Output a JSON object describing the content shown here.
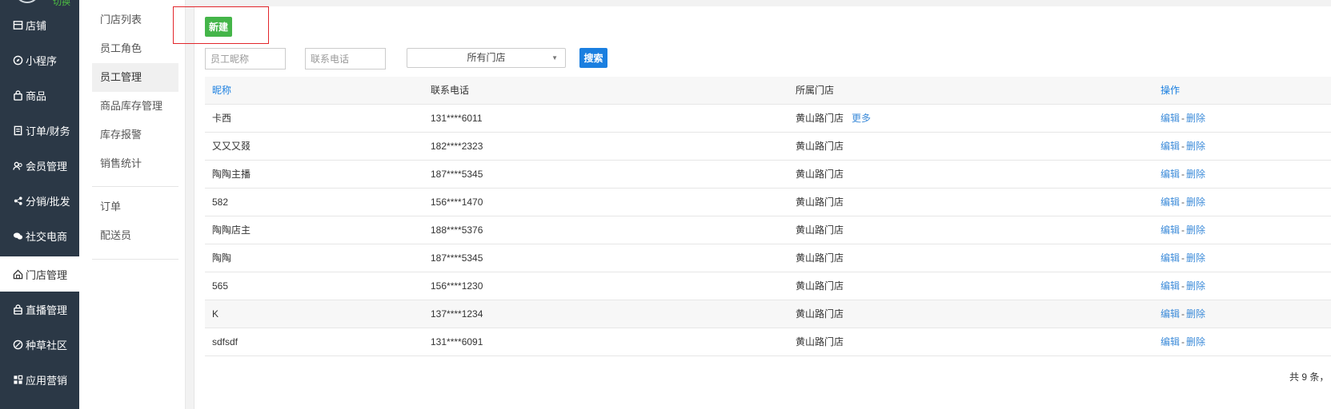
{
  "sidebar": {
    "top_text": "切换",
    "items": [
      {
        "label": "店铺",
        "icon": "store-icon"
      },
      {
        "label": "小程序",
        "icon": "compass-icon"
      },
      {
        "label": "商品",
        "icon": "bag-icon"
      },
      {
        "label": "订单/财务",
        "icon": "document-icon"
      },
      {
        "label": "会员管理",
        "icon": "users-icon"
      },
      {
        "label": "分销/批发",
        "icon": "share-icon"
      },
      {
        "label": "社交电商",
        "icon": "chat-icon"
      },
      {
        "label": "门店管理",
        "icon": "home-icon"
      },
      {
        "label": "直播管理",
        "icon": "lock-bag-icon"
      },
      {
        "label": "种草社区",
        "icon": "leaf-icon"
      },
      {
        "label": "应用营销",
        "icon": "apps-icon"
      }
    ],
    "active_index": 7
  },
  "submenu": {
    "items": [
      "门店列表",
      "员工角色",
      "员工管理",
      "商品库存管理",
      "库存报警",
      "销售统计"
    ],
    "items2": [
      "订单",
      "配送员"
    ],
    "active_index": 2
  },
  "toolbar": {
    "new_label": "新建",
    "nickname_placeholder": "员工昵称",
    "phone_placeholder": "联系电话",
    "store_select": "所有门店",
    "search_label": "搜索"
  },
  "table": {
    "headers": [
      "昵称",
      "联系电话",
      "所属门店",
      "操作"
    ],
    "rows": [
      {
        "name": "卡西",
        "phone": "131****6011",
        "store": "黄山路门店",
        "more": "更多"
      },
      {
        "name": "又又又叕",
        "phone": "182****2323",
        "store": "黄山路门店"
      },
      {
        "name": "陶陶主播",
        "phone": "187****5345",
        "store": "黄山路门店"
      },
      {
        "name": "582",
        "phone": "156****1470",
        "store": "黄山路门店"
      },
      {
        "name": "陶陶店主",
        "phone": "188****5376",
        "store": "黄山路门店"
      },
      {
        "name": "陶陶",
        "phone": "187****5345",
        "store": "黄山路门店"
      },
      {
        "name": "565",
        "phone": "156****1230",
        "store": "黄山路门店"
      },
      {
        "name": "K",
        "phone": "137****1234",
        "store": "黄山路门店"
      },
      {
        "name": "sdfsdf",
        "phone": "131****6091",
        "store": "黄山路门店"
      }
    ],
    "edit_label": "编辑",
    "separator": "-",
    "delete_label": "删除"
  },
  "pagination": {
    "total_text": "共 9 条，"
  },
  "colors": {
    "sidebar_bg": "#2b3846",
    "new_button": "#44b549",
    "search_button": "#1a7fe0",
    "link": "#3c8bd9",
    "highlight": "#e2262b"
  }
}
